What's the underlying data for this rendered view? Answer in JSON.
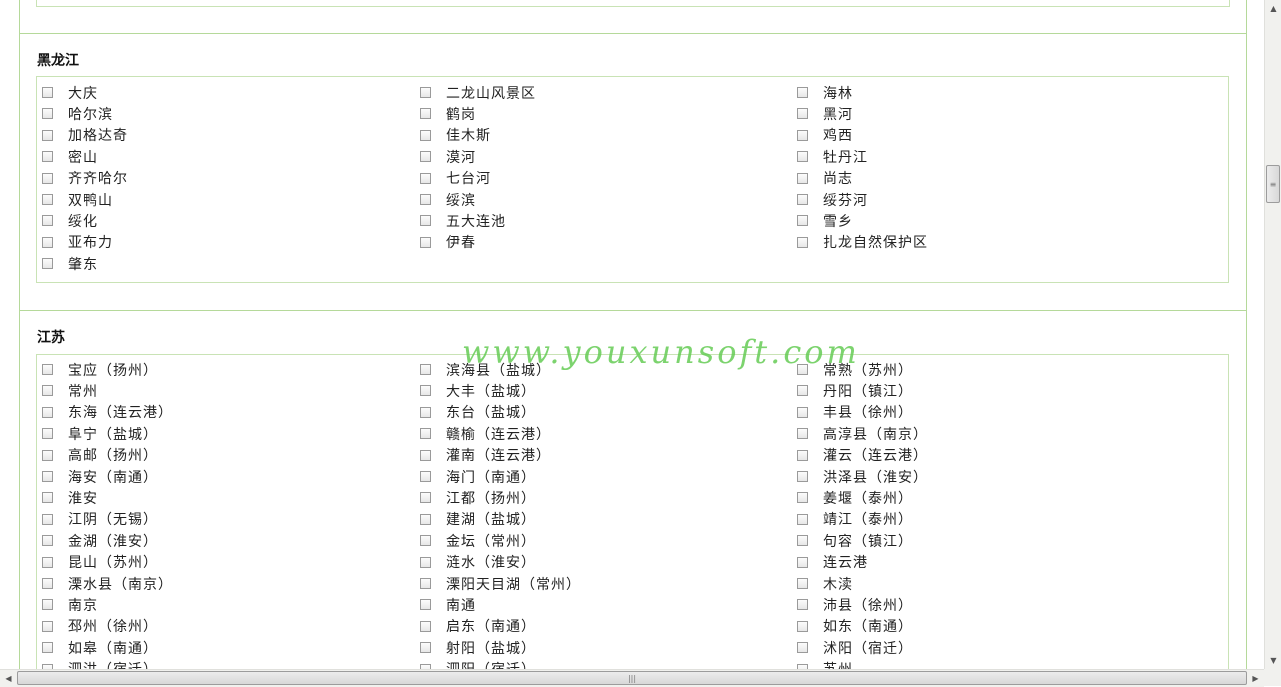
{
  "watermark": "www.youxunsoft.com",
  "sections": [
    {
      "title": "黑龙江",
      "columns": [
        [
          "大庆",
          "哈尔滨",
          "加格达奇",
          "密山",
          "齐齐哈尔",
          "双鸭山",
          "绥化",
          "亚布力",
          "肇东"
        ],
        [
          "二龙山风景区",
          "鹤岗",
          "佳木斯",
          "漠河",
          "七台河",
          "绥滨",
          "五大连池",
          "伊春"
        ],
        [
          "海林",
          "黑河",
          "鸡西",
          "牡丹江",
          "尚志",
          "绥芬河",
          "雪乡",
          "扎龙自然保护区"
        ]
      ]
    },
    {
      "title": "江苏",
      "columns": [
        [
          "宝应（扬州）",
          "常州",
          "东海（连云港）",
          "阜宁（盐城）",
          "高邮（扬州）",
          "海安（南通）",
          "淮安",
          "江阴（无锡）",
          "金湖（淮安）",
          "昆山（苏州）",
          "溧水县（南京）",
          "南京",
          "邳州（徐州）",
          "如皋（南通）",
          "泗洪（宿迁）"
        ],
        [
          "滨海县（盐城）",
          "大丰（盐城）",
          "东台（盐城）",
          "赣榆（连云港）",
          "灌南（连云港）",
          "海门（南通）",
          "江都（扬州）",
          "建湖（盐城）",
          "金坛（常州）",
          "涟水（淮安）",
          "溧阳天目湖（常州）",
          "南通",
          "启东（南通）",
          "射阳（盐城）",
          "泗阳（宿迁）"
        ],
        [
          "常熟（苏州）",
          "丹阳（镇江）",
          "丰县（徐州）",
          "高淳县（南京）",
          "灌云（连云港）",
          "洪泽县（淮安）",
          "姜堰（泰州）",
          "靖江（泰州）",
          "句容（镇江）",
          "连云港",
          "木渎",
          "沛县（徐州）",
          "如东（南通）",
          "沭阳（宿迁）",
          "苏州"
        ]
      ]
    }
  ],
  "scrollbars": {
    "vertical_thumb_glyph": "≡",
    "horizontal_thumb_glyph": "|||",
    "up_arrow": "▲",
    "down_arrow": "▼",
    "left_arrow": "◀",
    "right_arrow": "▶"
  }
}
